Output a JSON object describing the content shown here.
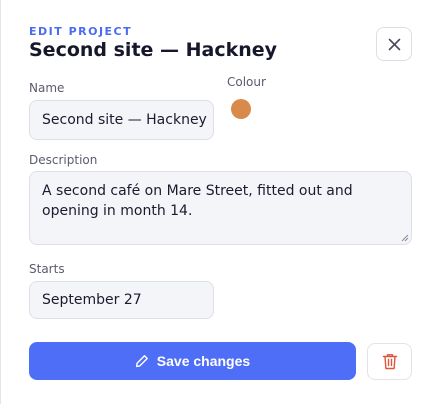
{
  "header": {
    "eyebrow": "EDIT PROJECT",
    "title": "Second site — Hackney",
    "close_icon": "close-icon"
  },
  "form": {
    "name": {
      "label": "Name",
      "value": "Second site — Hackney"
    },
    "colour": {
      "label": "Colour",
      "value": "#d98a4a"
    },
    "description": {
      "label": "Description",
      "value": "A second café on Mare Street, fitted out and opening in month 14."
    },
    "starts": {
      "label": "Starts",
      "value": "September 27"
    }
  },
  "actions": {
    "save_label": "Save changes",
    "save_icon": "pencil-icon",
    "delete_icon": "trash-icon"
  },
  "colors": {
    "accent": "#4f6ef7",
    "danger": "#e0533d"
  }
}
